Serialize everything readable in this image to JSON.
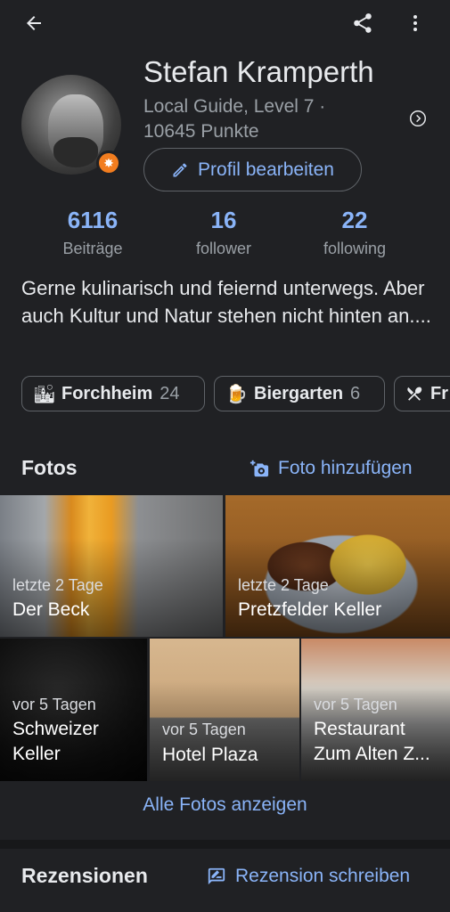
{
  "profile": {
    "name": "Stefan Kramperth",
    "level_line1": "Local Guide, Level 7 ·",
    "level_line2": "10645 Punkte",
    "edit_label": "Profil bearbeiten"
  },
  "stats": [
    {
      "value": "6116",
      "label": "Beiträge"
    },
    {
      "value": "16",
      "label": "follower"
    },
    {
      "value": "22",
      "label": "following"
    }
  ],
  "bio": "Gerne kulinarisch und feiernd unterwegs. Aber auch Kultur und Natur stehen nicht hinten an....",
  "chips": [
    {
      "icon": "city-icon",
      "name": "Forchheim",
      "count": "24"
    },
    {
      "icon": "beer-icon",
      "name": "Biergarten",
      "count": "6"
    },
    {
      "icon": "fork-knife-icon",
      "name": "Fr",
      "count": ""
    }
  ],
  "fotos": {
    "title": "Fotos",
    "add_label": "Foto hinzufügen",
    "tiles": [
      {
        "when": "letzte 2 Tage",
        "place": "Der Beck"
      },
      {
        "when": "letzte 2 Tage",
        "place": "Pretzfelder Keller"
      },
      {
        "when": "vor 5 Tagen",
        "place": "Schweizer Keller"
      },
      {
        "when": "vor 5 Tagen",
        "place": "Hotel Plaza"
      },
      {
        "when": "vor 5 Tagen",
        "place": "Restaurant Zum Alten Z..."
      }
    ],
    "all_label": "Alle Fotos anzeigen"
  },
  "reviews": {
    "title": "Rezensionen",
    "write_label": "Rezension schreiben"
  },
  "colors": {
    "accent": "#8ab4f8",
    "background": "#202124",
    "badge": "#f27d1f"
  }
}
